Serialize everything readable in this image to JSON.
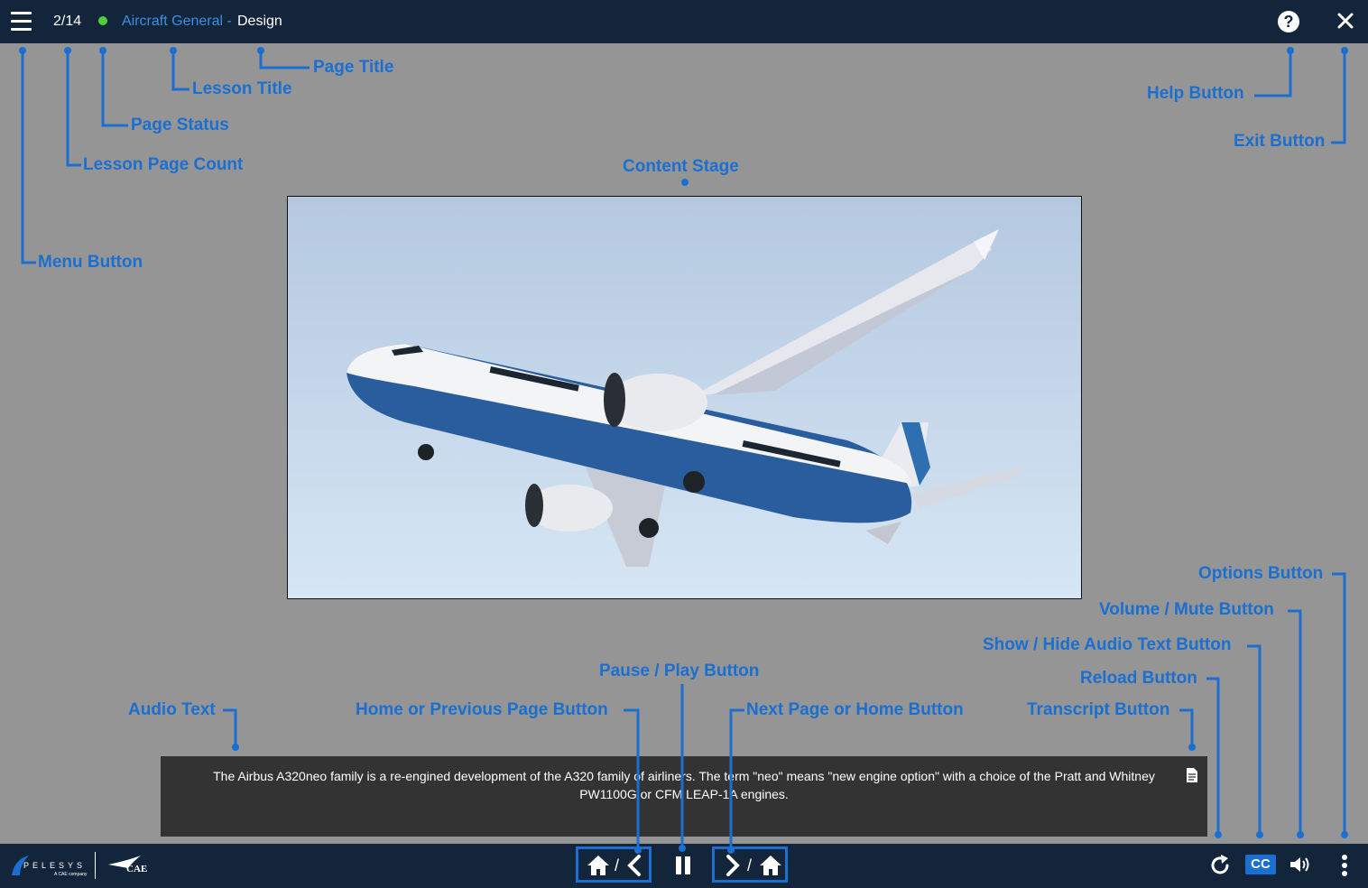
{
  "header": {
    "page_count": "2/14",
    "lesson_title": "Aircraft General -",
    "page_title": "Design",
    "help_label": "?"
  },
  "stage": {
    "image_icon": "airplane-illustration"
  },
  "audio": {
    "text": "The Airbus A320neo family is a re-engined development of the A320 family of airliners. The term \"neo\" means \"new engine option\" with a choice of the Pratt and Whitney PW1100G or CFM LEAP-1A engines."
  },
  "footer": {
    "cc_label": "CC",
    "slash": "/",
    "logo_pelesys": "PELESYS",
    "logo_pelesys_sub": "A CAE company",
    "logo_cae": "CAE"
  },
  "annotations": {
    "menu": "Menu Button",
    "page_count": "Lesson Page Count",
    "page_status": "Page Status",
    "lesson_title": "Lesson Title",
    "page_title": "Page Title",
    "help": "Help Button",
    "exit": "Exit Button",
    "content_stage": "Content Stage",
    "options": "Options Button",
    "volume": "Volume / Mute Button",
    "show_hide": "Show / Hide Audio Text Button",
    "reload": "Reload Button",
    "transcript": "Transcript Button",
    "pause_play": "Pause / Play Button",
    "home_prev": "Home or Previous Page Button",
    "next_home": "Next Page or Home Button",
    "audio_text": "Audio Text"
  },
  "colors": {
    "accent": "#1a6fd1",
    "bar": "#13253a",
    "status": "#4ccf3a"
  }
}
